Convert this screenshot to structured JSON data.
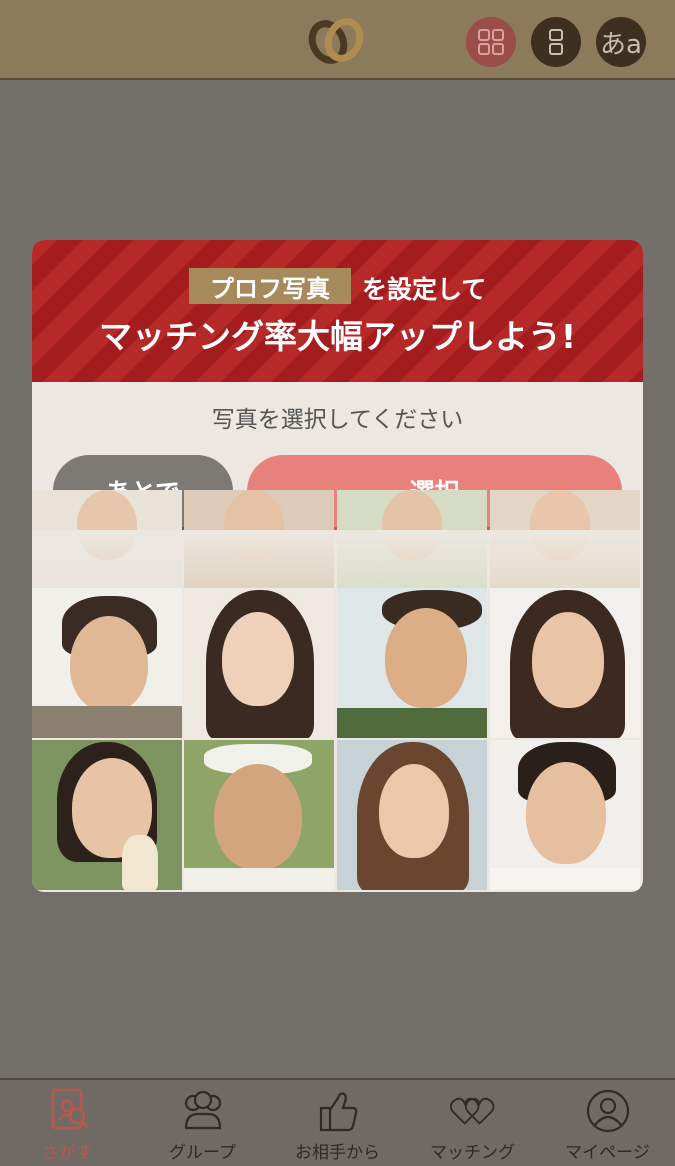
{
  "header": {
    "logo": "rings-logo",
    "buttons": [
      {
        "icon": "grid-view-icon"
      },
      {
        "icon": "list-view-icon"
      },
      {
        "icon": "font-size-icon",
        "label": "あa"
      }
    ]
  },
  "modal": {
    "tag": "プロフ写真",
    "tag_suffix": "を設定して",
    "headline": "マッチング率大幅アップしよう!",
    "prompt": "写真を選択してください",
    "later_button": "あとで",
    "select_button": "選択"
  },
  "nav": {
    "items": [
      {
        "label": "さがす",
        "icon": "search-profile-icon",
        "active": true
      },
      {
        "label": "グループ",
        "icon": "group-icon",
        "active": false
      },
      {
        "label": "お相手から",
        "icon": "thumbs-up-icon",
        "active": false
      },
      {
        "label": "マッチング",
        "icon": "hearts-icon",
        "active": false
      },
      {
        "label": "マイページ",
        "icon": "user-icon",
        "active": false
      }
    ]
  },
  "colors": {
    "header_bg": "#8c7a5d",
    "banner_red": "#b52a29",
    "tag_gold": "#a68a5b",
    "select_pink": "#e8807b",
    "later_gray": "#7d7a75",
    "active_nav": "#b9564f"
  }
}
